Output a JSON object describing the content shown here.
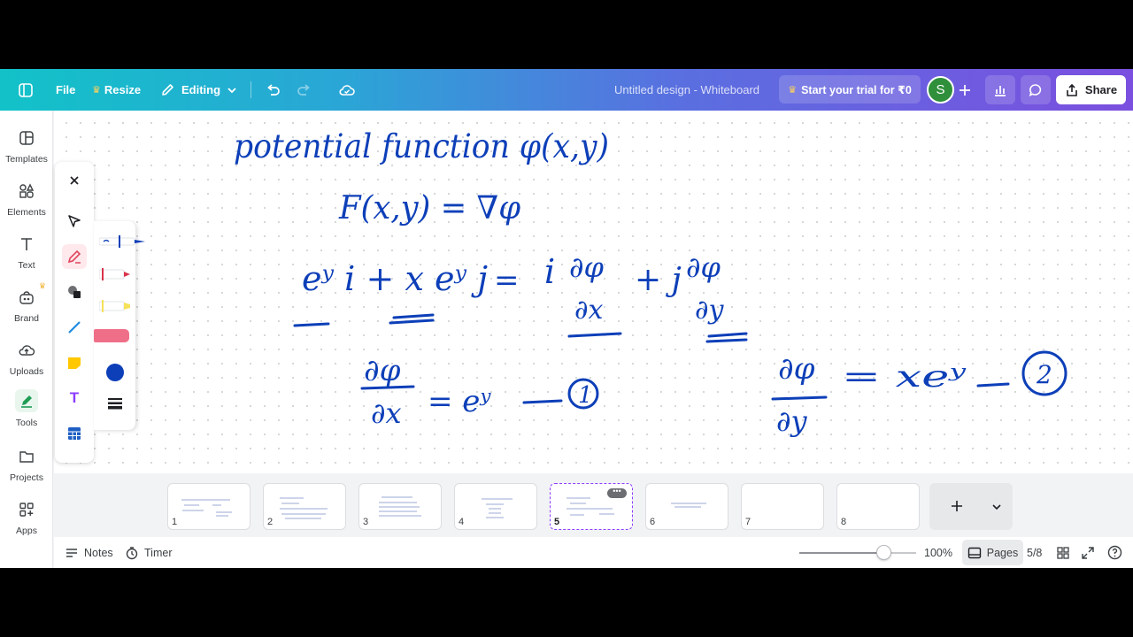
{
  "topbar": {
    "file_label": "File",
    "resize_label": "Resize",
    "editing_label": "Editing",
    "doc_title": "Untitled design - Whiteboard",
    "trial_label": "Start your trial for ₹0",
    "avatar_initial": "S",
    "share_label": "Share",
    "colors": {
      "gradient_start": "#12c2c8",
      "gradient_end": "#7b4fdf",
      "avatar": "#2f8f3a"
    }
  },
  "sidebar": {
    "items": [
      {
        "label": "Templates",
        "icon": "templates-icon"
      },
      {
        "label": "Elements",
        "icon": "elements-icon"
      },
      {
        "label": "Text",
        "icon": "text-icon"
      },
      {
        "label": "Brand",
        "icon": "brand-icon"
      },
      {
        "label": "Uploads",
        "icon": "uploads-icon"
      },
      {
        "label": "Tools",
        "icon": "tools-icon"
      },
      {
        "label": "Projects",
        "icon": "projects-icon"
      },
      {
        "label": "Apps",
        "icon": "apps-icon"
      }
    ]
  },
  "toolpanel": {
    "tools": [
      "close-icon",
      "select-arrow-icon",
      "pen-icon",
      "shapes-icon",
      "line-icon",
      "sticky-note-icon",
      "text-tool-icon",
      "table-icon"
    ],
    "pens": [
      "pen-blue",
      "marker-red",
      "highlighter-yellow",
      "eraser-pink"
    ],
    "current_color": "#0d3fb8"
  },
  "whiteboard": {
    "line1": "potential function φ(x,y)",
    "line2": "F(x,y) = ∇φ",
    "eq_left": "eʸ i + x eʸ j",
    "eq_right_i": "i",
    "eq_right_j": "+ j",
    "frac1_num": "∂φ",
    "frac1_den": "∂x",
    "frac2_num": "∂φ",
    "frac2_den": "∂y",
    "eq1_lhs_num": "∂φ",
    "eq1_lhs_den": "∂x",
    "eq1_rhs": "= eʸ",
    "eq1_tag": "1",
    "eq2_lhs_num": "∂φ",
    "eq2_lhs_den": "∂y",
    "eq2_rhs": "= xeʸ",
    "eq2_tag": "2"
  },
  "pages": {
    "thumbs": [
      "1",
      "2",
      "3",
      "4",
      "5",
      "6",
      "7",
      "8"
    ],
    "active": "5"
  },
  "footer": {
    "notes_label": "Notes",
    "timer_label": "Timer",
    "zoom_label": "100%",
    "zoom_value": 0.72,
    "pages_label": "Pages",
    "page_count": "5/8"
  }
}
